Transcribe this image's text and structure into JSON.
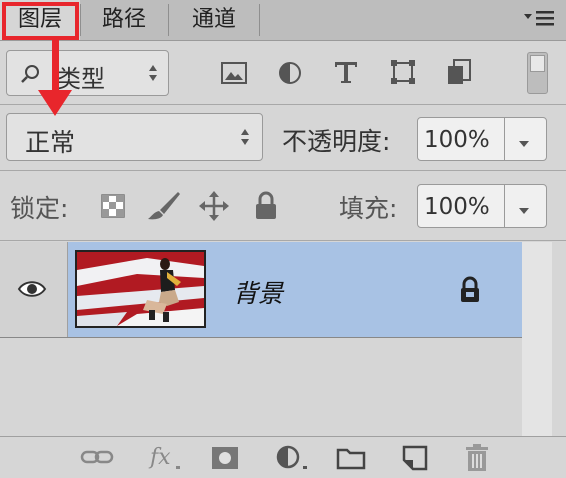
{
  "tabs": [
    {
      "label": "图层",
      "active": true
    },
    {
      "label": "路径",
      "active": false
    },
    {
      "label": "通道",
      "active": false
    }
  ],
  "panel_menu_icon": "panel-menu-icon",
  "filter": {
    "kind_label": "类型",
    "icons": [
      "image-filter-icon",
      "adjustment-filter-icon",
      "type-filter-icon",
      "shape-filter-icon",
      "smart-object-filter-icon"
    ]
  },
  "blend": {
    "mode": "正常",
    "opacity_label": "不透明度:",
    "opacity_value": "100%"
  },
  "lock": {
    "label": "锁定:",
    "fill_label": "填充:",
    "fill_value": "100%"
  },
  "layers": [
    {
      "name": "背景",
      "locked": true,
      "visible": true
    }
  ],
  "bottom_icons": [
    "link-icon",
    "fx-icon",
    "mask-icon",
    "adjustment-icon",
    "folder-icon",
    "new-layer-icon",
    "trash-icon"
  ],
  "colors": {
    "accent_red": "#e8262c",
    "selected_layer": "#a8c2e4"
  }
}
